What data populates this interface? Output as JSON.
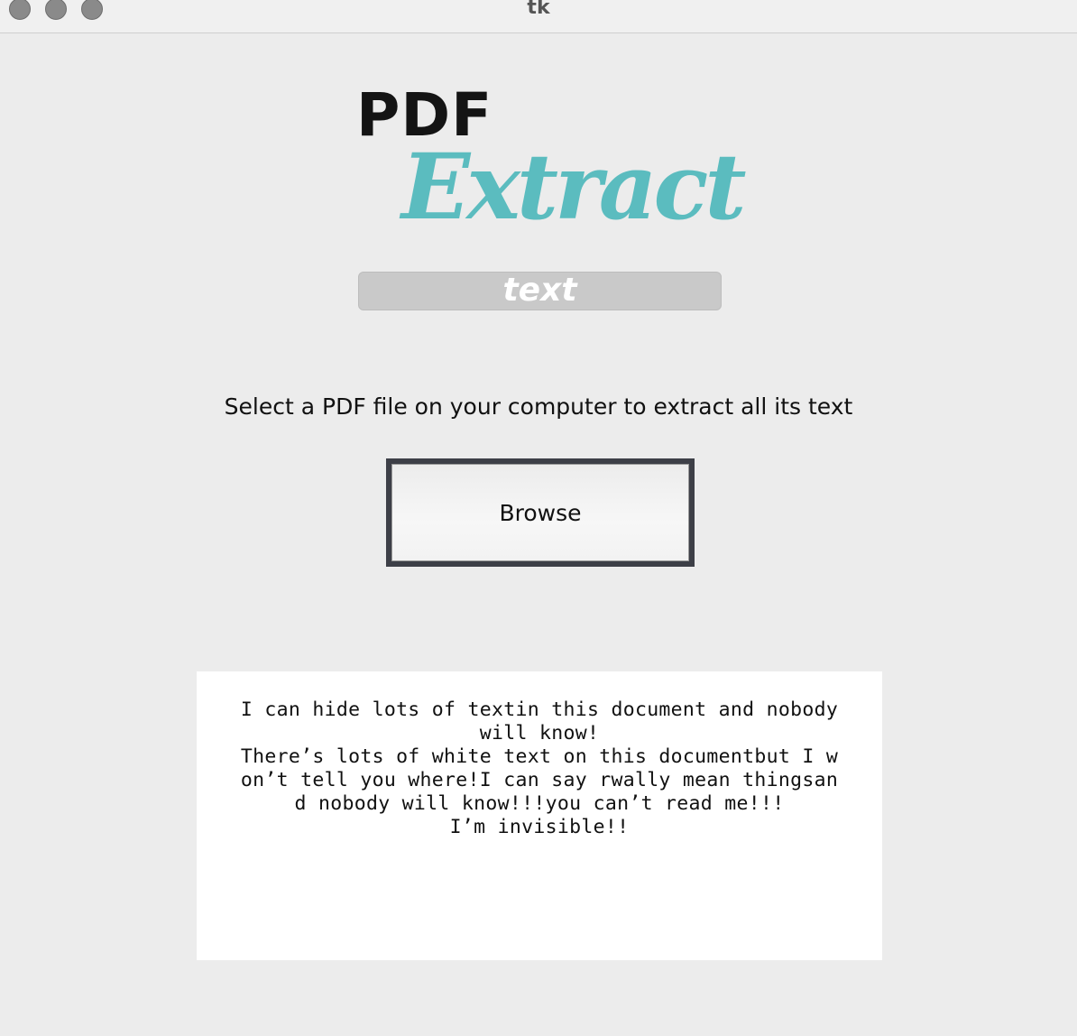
{
  "window": {
    "title": "tk"
  },
  "logo": {
    "line1": "PDF",
    "line2": "Extract",
    "line3": "text",
    "accent_color": "#5bbcbf"
  },
  "prompt": {
    "text": "Select a PDF file on your computer to extract all its text"
  },
  "browse_button": {
    "label": "Browse"
  },
  "output": {
    "lines": [
      "I can hide lots of textin this document and nobody",
      "will know!",
      "There’s lots of white text on this documentbut I w",
      "on’t tell you where!I can say rwally mean thingsan",
      "d nobody will know!!!you can’t read me!!!",
      "I’m invisible!!"
    ]
  }
}
